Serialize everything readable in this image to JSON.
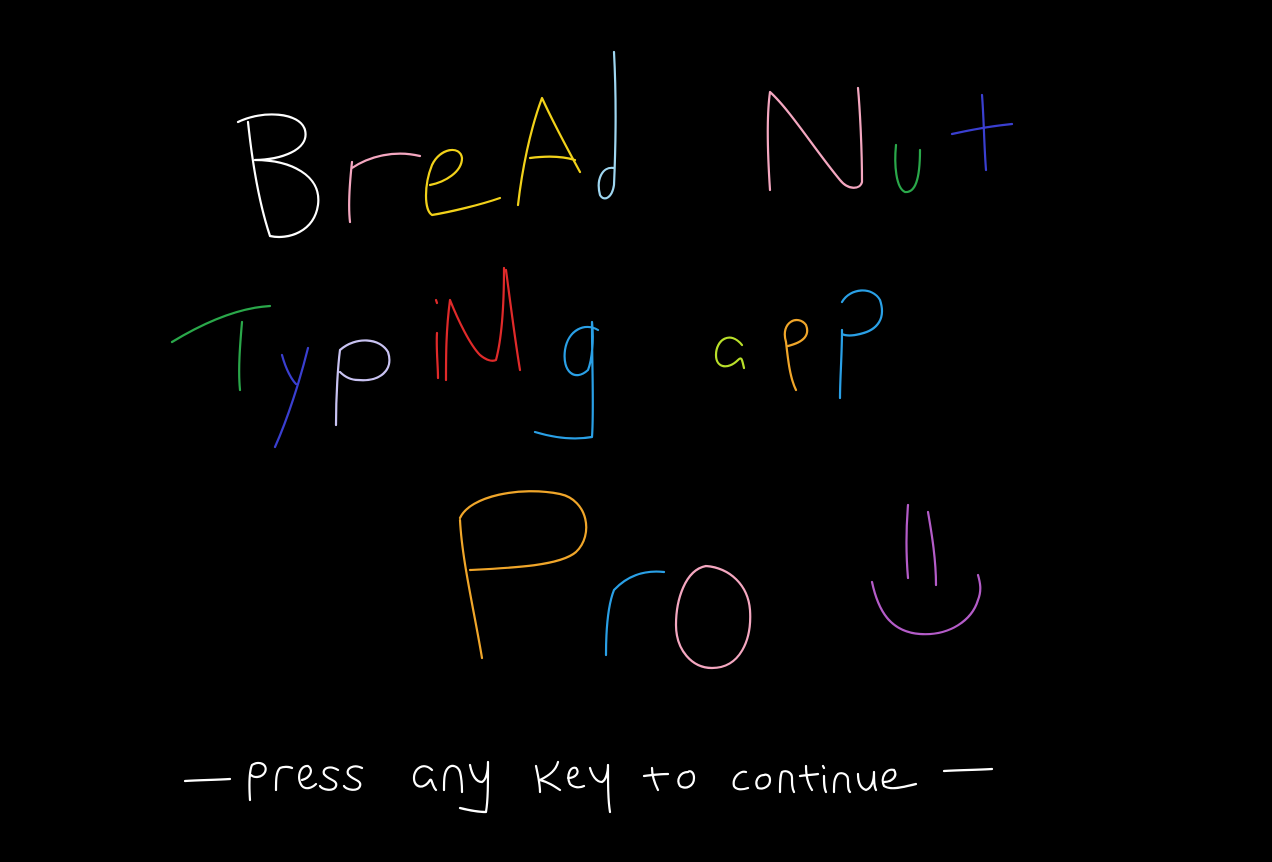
{
  "title": {
    "line1": "BreAd Nut",
    "line2": "TypiNg app",
    "line3": "Pro"
  },
  "prompt": "— press any key to continue —",
  "colors": {
    "background": "#000000",
    "white": "#ffffff",
    "pink": "#f4a7c0",
    "yellow": "#f2d21a",
    "orange": "#f0a62a",
    "light_blue": "#9fd6f0",
    "green": "#2aa84a",
    "dark_blue": "#3a3fd0",
    "lavender": "#c9c3f2",
    "red": "#e02a2a",
    "sky_blue": "#2aa0e6",
    "lime": "#b9e02a",
    "purple": "#b45cc8"
  },
  "icons": {
    "smiley": "hand-drawn-smiley-icon"
  }
}
